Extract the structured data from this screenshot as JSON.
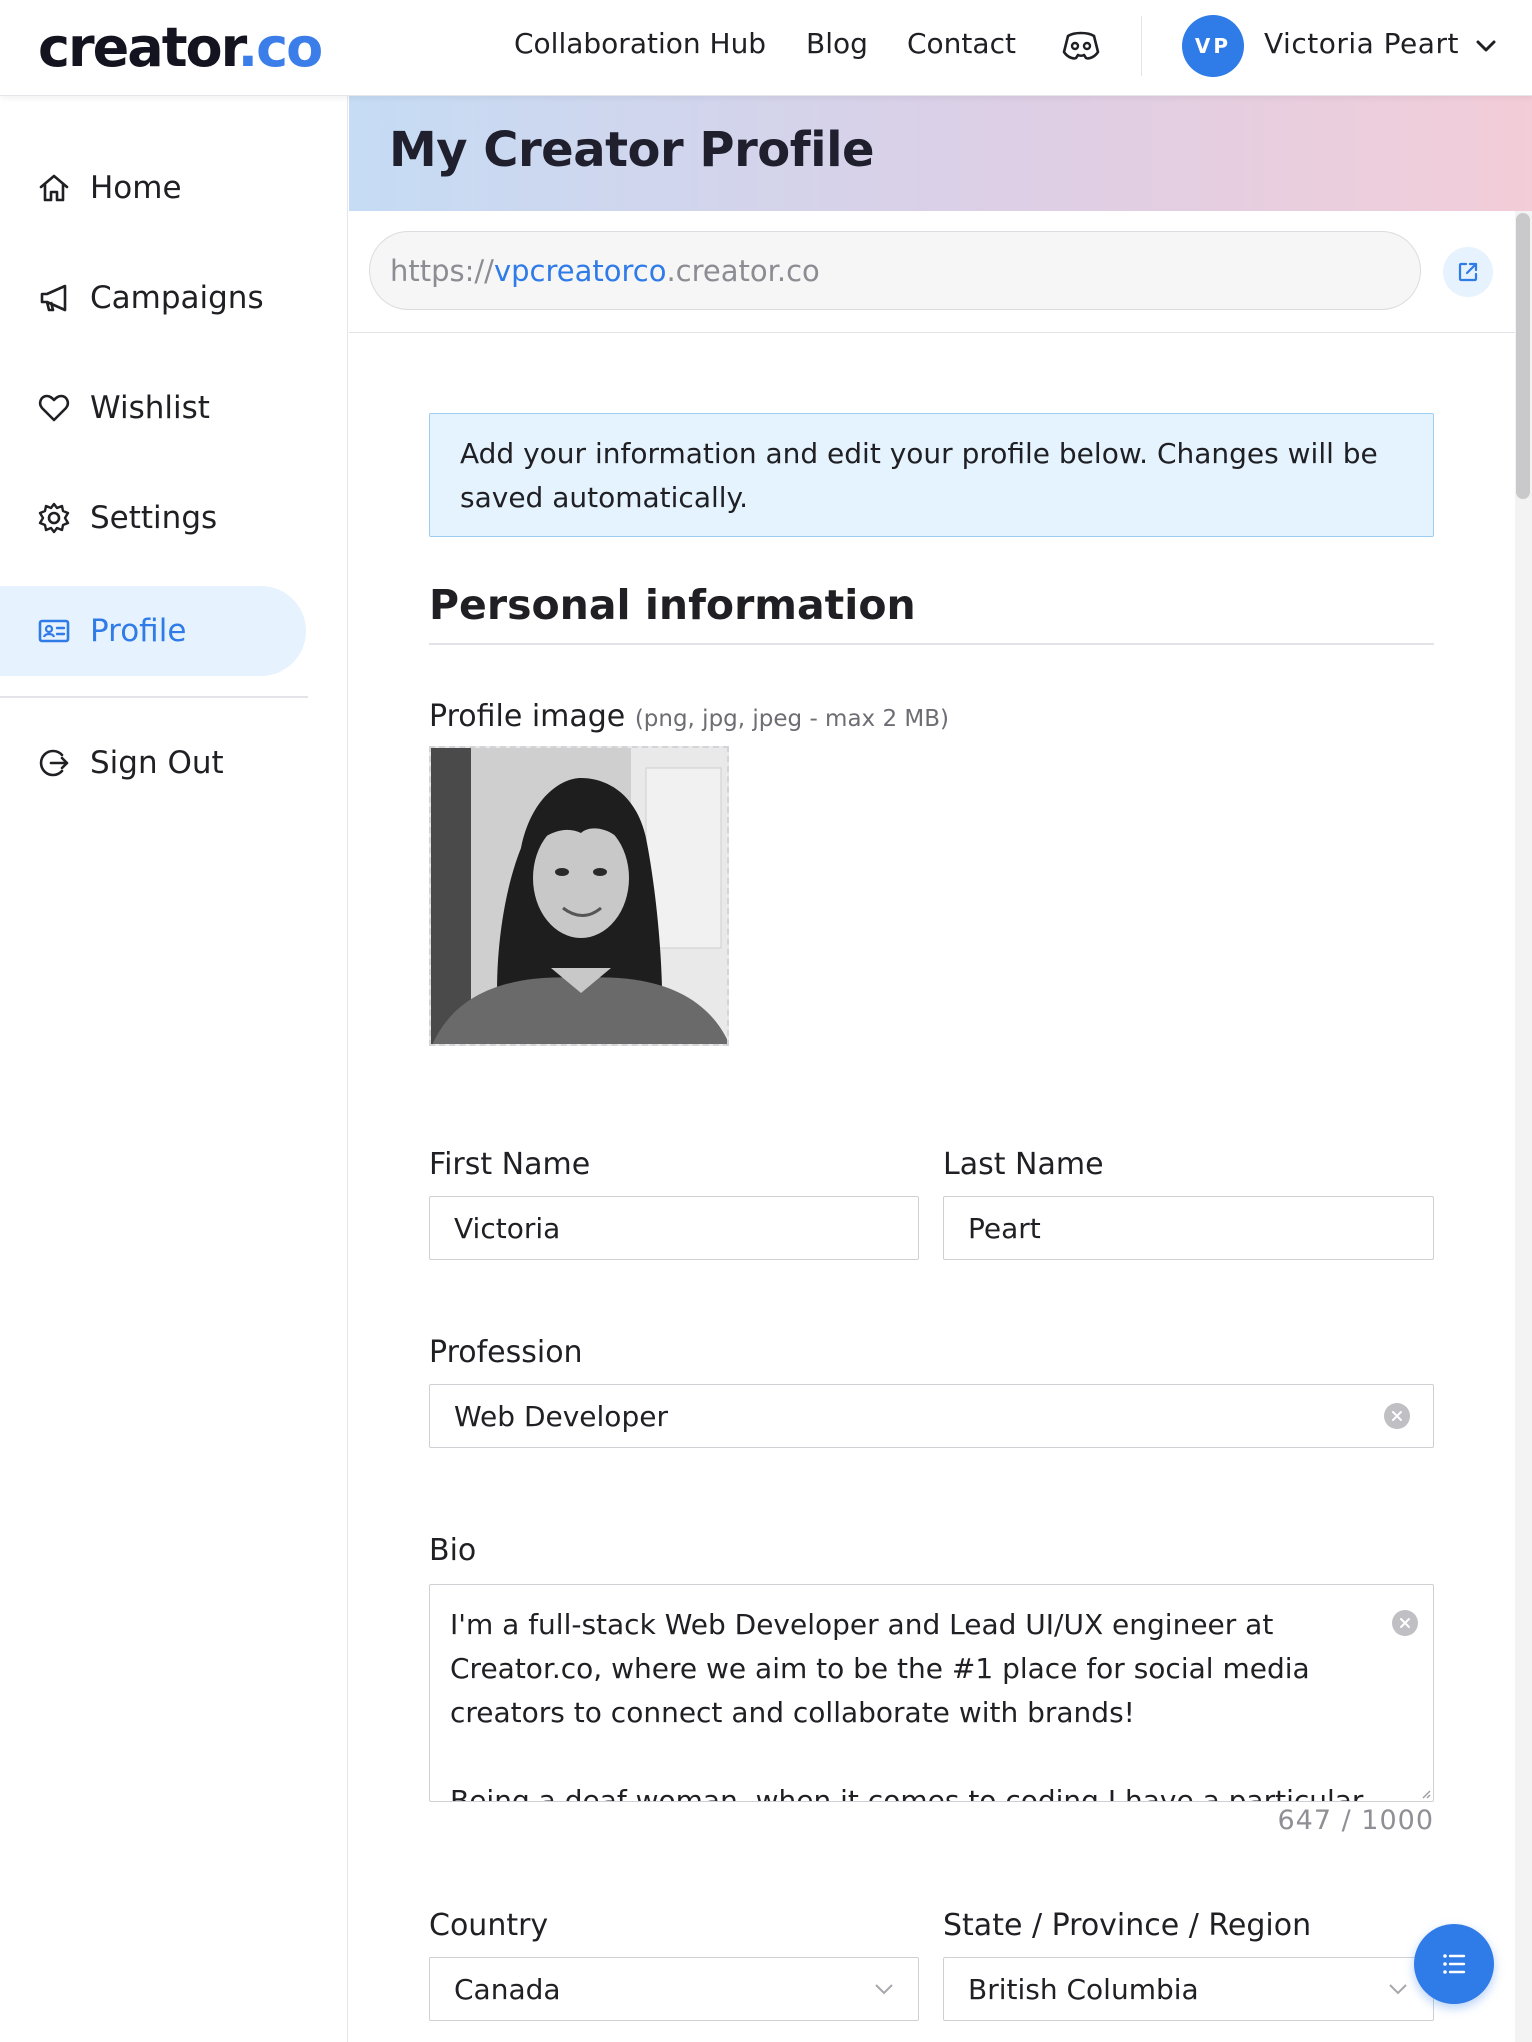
{
  "header": {
    "logo_part1": "creator",
    "logo_part2": ".co",
    "nav": {
      "collab": "Collaboration Hub",
      "blog": "Blog",
      "contact": "Contact"
    },
    "user": {
      "initials": "VP",
      "name": "Victoria Peart"
    }
  },
  "sidebar": {
    "items": [
      {
        "label": "Home",
        "icon": "home-icon"
      },
      {
        "label": "Campaigns",
        "icon": "megaphone-icon"
      },
      {
        "label": "Wishlist",
        "icon": "heart-icon"
      },
      {
        "label": "Settings",
        "icon": "gear-icon"
      },
      {
        "label": "Profile",
        "icon": "profile-card-icon",
        "active": true
      }
    ],
    "signout": {
      "label": "Sign Out",
      "icon": "sign-out-icon"
    }
  },
  "page": {
    "title": "My Creator Profile",
    "url_prefix": "https://",
    "url_sub": "vpcreatorco",
    "url_domain": ".creator.co",
    "info": "Add your information and edit your profile below. Changes will be saved automatically.",
    "section_title": "Personal information"
  },
  "form": {
    "profile_image_label": "Profile image",
    "profile_image_hint": "(png, jpg, jpeg - max 2 MB)",
    "first_name_label": "First Name",
    "first_name": "Victoria",
    "last_name_label": "Last Name",
    "last_name": "Peart",
    "profession_label": "Profession",
    "profession": "Web Developer",
    "bio_label": "Bio",
    "bio": "I'm a full-stack Web Developer and Lead UI/UX engineer at Creator.co, where we aim to be the #1 place for social media creators to connect and collaborate with brands!\n\nBeing a deaf woman, when it comes to coding I have a particular",
    "bio_counter": "647 / 1000",
    "country_label": "Country",
    "country": "Canada",
    "region_label": "State / Province / Region",
    "region": "British Columbia"
  },
  "colors": {
    "accent": "#2f7be8",
    "active_bg": "#e6f2fd",
    "info_bg": "#e4f3fd"
  }
}
